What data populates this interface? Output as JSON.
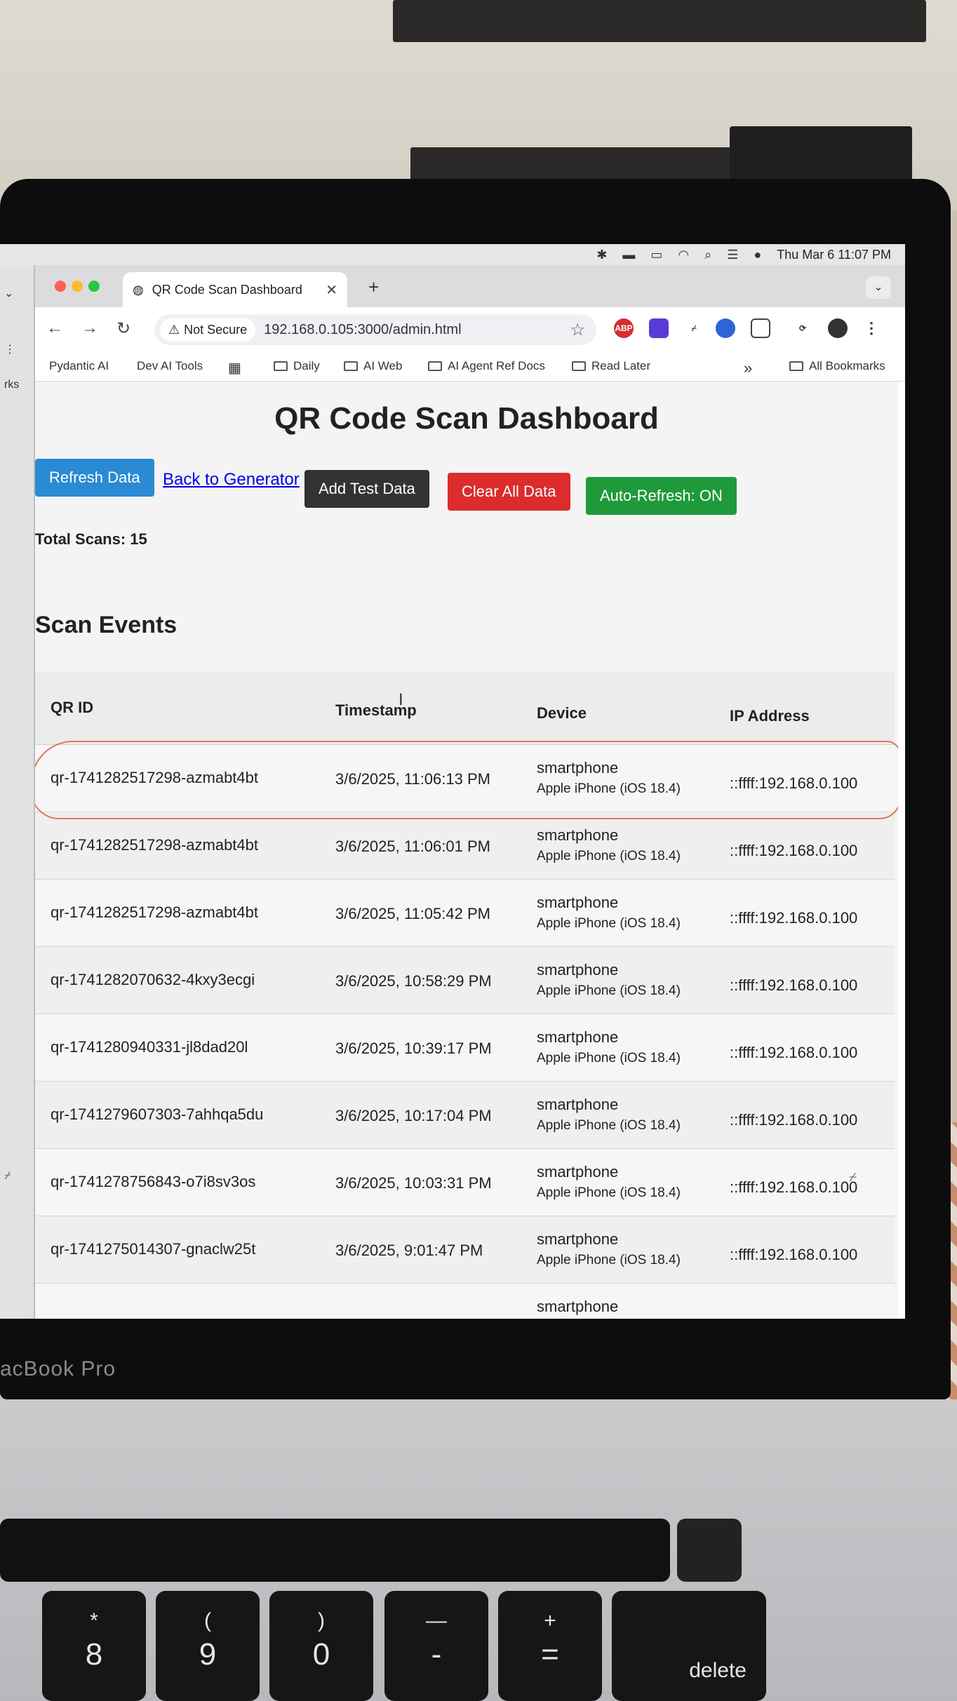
{
  "menubar": {
    "datetime": "Thu Mar 6  11:07 PM",
    "icons": [
      "bluetooth-icon",
      "bed-icon",
      "battery-icon",
      "wifi-icon",
      "search-icon",
      "control-center-icon",
      "siri-icon"
    ]
  },
  "browser": {
    "tab_title": "QR Code Scan Dashboard",
    "security_label": "Not Secure",
    "url": "192.168.0.105:3000/admin.html",
    "side_window_label": "rks",
    "bookmarks": [
      "Pydantic AI",
      "Dev AI Tools",
      "Daily",
      "AI Web",
      "AI Agent Ref Docs",
      "Read Later"
    ],
    "overflow_label": "»",
    "all_bookmarks": "All Bookmarks",
    "extensions": [
      "ABP",
      "",
      "",
      "",
      "",
      "",
      ""
    ]
  },
  "page": {
    "title": "QR Code Scan Dashboard",
    "refresh_label": "Refresh Data",
    "back_label": "Back to Generator",
    "add_test_label": "Add Test Data",
    "clear_label": "Clear All Data",
    "autorefresh_label": "Auto-Refresh: ON",
    "total_scans": "Total Scans: 15",
    "section_title": "Scan Events",
    "colors": {
      "refresh": "#2a8ad3",
      "add_test": "#333333",
      "clear": "#dc2c2c",
      "autorefresh": "#1f9a3a",
      "highlight": "#e8735e"
    }
  },
  "table": {
    "headers": [
      "QR ID",
      "Timestamp",
      "Device",
      "IP Address"
    ],
    "rows": [
      {
        "qr": "qr-1741282517298-azmabt4bt",
        "ts": "3/6/2025, 11:06:13 PM",
        "device": "smartphone",
        "model": "Apple iPhone (iOS 18.4)",
        "ip": "::ffff:192.168.0.100"
      },
      {
        "qr": "qr-1741282517298-azmabt4bt",
        "ts": "3/6/2025, 11:06:01 PM",
        "device": "smartphone",
        "model": "Apple iPhone (iOS 18.4)",
        "ip": "::ffff:192.168.0.100"
      },
      {
        "qr": "qr-1741282517298-azmabt4bt",
        "ts": "3/6/2025, 11:05:42 PM",
        "device": "smartphone",
        "model": "Apple iPhone (iOS 18.4)",
        "ip": "::ffff:192.168.0.100"
      },
      {
        "qr": "qr-1741282070632-4kxy3ecgi",
        "ts": "3/6/2025, 10:58:29 PM",
        "device": "smartphone",
        "model": "Apple iPhone (iOS 18.4)",
        "ip": "::ffff:192.168.0.100"
      },
      {
        "qr": "qr-1741280940331-jl8dad20l",
        "ts": "3/6/2025, 10:39:17 PM",
        "device": "smartphone",
        "model": "Apple iPhone (iOS 18.4)",
        "ip": "::ffff:192.168.0.100"
      },
      {
        "qr": "qr-1741279607303-7ahhqa5du",
        "ts": "3/6/2025, 10:17:04 PM",
        "device": "smartphone",
        "model": "Apple iPhone (iOS 18.4)",
        "ip": "::ffff:192.168.0.100"
      },
      {
        "qr": "qr-1741278756843-o7i8sv3os",
        "ts": "3/6/2025, 10:03:31 PM",
        "device": "smartphone",
        "model": "Apple iPhone (iOS 18.4)",
        "ip": "::ffff:192.168.0.100"
      },
      {
        "qr": "qr-1741275014307-gnaclw25t",
        "ts": "3/6/2025, 9:01:47 PM",
        "device": "smartphone",
        "model": "Apple iPhone (iOS 18.4)",
        "ip": "::ffff:192.168.0.100"
      },
      {
        "qr": "",
        "ts": "",
        "device": "smartphone",
        "model": "",
        "ip": ""
      }
    ]
  },
  "laptop": {
    "brand_label": "acBook Pro",
    "keys": [
      {
        "top": "*",
        "bottom": "8"
      },
      {
        "top": "(",
        "bottom": "9"
      },
      {
        "top": ")",
        "bottom": "0"
      },
      {
        "top": "—",
        "bottom": "-"
      },
      {
        "top": "+",
        "bottom": "="
      }
    ],
    "delete_label": "delete"
  }
}
